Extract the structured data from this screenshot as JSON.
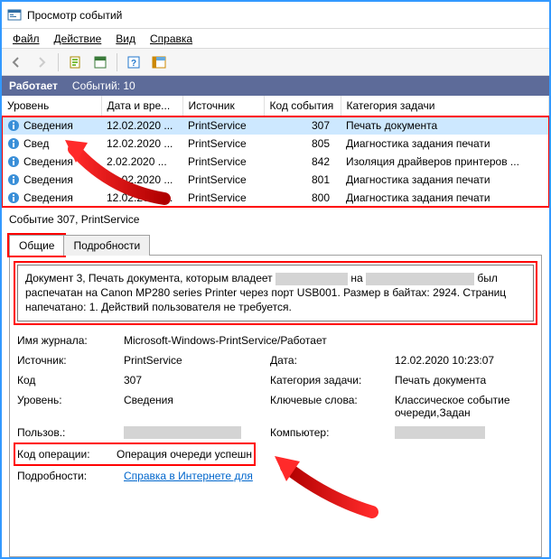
{
  "window": {
    "title": "Просмотр событий"
  },
  "menu": {
    "file": "Файл",
    "action": "Действие",
    "view": "Вид",
    "help": "Справка"
  },
  "status": {
    "state": "Работает",
    "count_label": "Событий: 10"
  },
  "columns": {
    "level": "Уровень",
    "date": "Дата и вре...",
    "source": "Источник",
    "event_id": "Код события",
    "category": "Категория задачи"
  },
  "rows": [
    {
      "level": "Сведения",
      "date": "12.02.2020 ...",
      "source": "PrintService",
      "id": "307",
      "cat": "Печать документа"
    },
    {
      "level": "Свед",
      "date": "12.02.2020 ...",
      "source": "PrintService",
      "id": "805",
      "cat": "Диагностика задания печати"
    },
    {
      "level": "Сведения",
      "date": "2.02.2020 ...",
      "source": "PrintService",
      "id": "842",
      "cat": "Изоляция драйверов принтеров ..."
    },
    {
      "level": "Сведения",
      "date": "12.02.2020 ...",
      "source": "PrintService",
      "id": "801",
      "cat": "Диагностика задания печати"
    },
    {
      "level": "Сведения",
      "date": "12.02.2020 ...",
      "source": "PrintService",
      "id": "800",
      "cat": "Диагностика задания печати"
    }
  ],
  "detail": {
    "header": "Событие 307, PrintService",
    "tabs": {
      "general": "Общие",
      "details": "Подробности"
    },
    "description_before": "Документ 3, Печать документа, которым владеет ",
    "description_mid": " на ",
    "description_after": " был распечатан на Canon MP280 series Printer через порт USB001.  Размер в байтах: 2924. Страниц напечатано: 1. Действий пользователя не требуется.",
    "kv": {
      "log_label": "Имя журнала:",
      "log_value": "Microsoft-Windows-PrintService/Работает",
      "source_label": "Источник:",
      "source_value": "PrintService",
      "date_label": "Дата:",
      "date_value": "12.02.2020 10:23:07",
      "id_label": "Код",
      "id_value": "307",
      "cat_label": "Категория задачи:",
      "cat_value": "Печать документа",
      "level_label": "Уровень:",
      "level_value": "Сведения",
      "keywords_label": "Ключевые слова:",
      "keywords_value": "Классическое событие очереди,Задан",
      "user_label": "Пользов.:",
      "computer_label": "Компьютер:",
      "op_label": "Код операции:",
      "op_value": "Операция очереди успешн",
      "more_label": "Подробности:",
      "more_link": "Справка в Интернете для "
    }
  }
}
